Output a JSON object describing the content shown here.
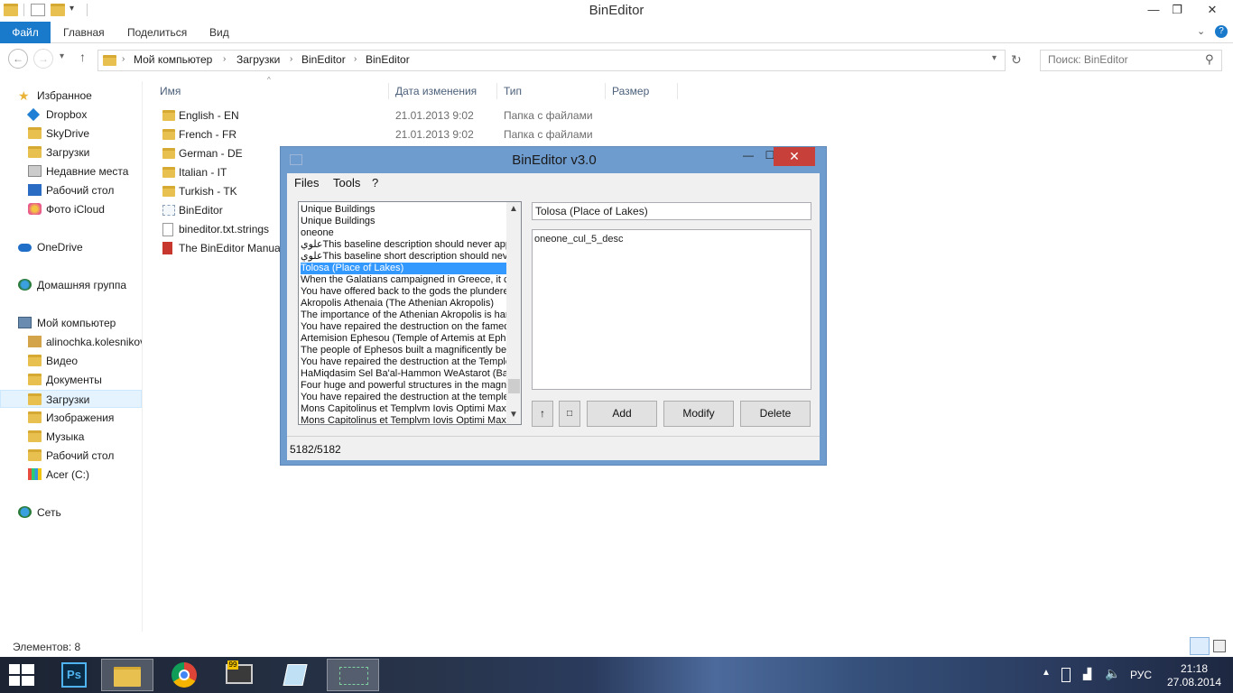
{
  "window_title": "BinEditor",
  "ribbon": {
    "file": "Файл",
    "tabs": [
      "Главная",
      "Поделиться",
      "Вид"
    ]
  },
  "address": {
    "path": [
      "Мой компьютер",
      "Загрузки",
      "BinEditor",
      "BinEditor"
    ]
  },
  "search": {
    "placeholder": "Поиск: BinEditor"
  },
  "nav": {
    "favorites": "Избранное",
    "fav_items": [
      "Dropbox",
      "SkyDrive",
      "Загрузки",
      "Недавние места",
      "Рабочий стол",
      "Фото iCloud"
    ],
    "onedrive": "OneDrive",
    "homegroup": "Домашняя группа",
    "computer": "Мой компьютер",
    "computer_items": [
      "alinochka.kolesnikov",
      "Видео",
      "Документы",
      "Загрузки",
      "Изображения",
      "Музыка",
      "Рабочий стол",
      "Acer (C:)"
    ],
    "network": "Сеть"
  },
  "columns": [
    "Имя",
    "Дата изменения",
    "Тип",
    "Размер"
  ],
  "files": [
    {
      "name": "English - EN",
      "date": "21.01.2013 9:02",
      "type": "Папка с файлами",
      "icon": "folder-icon"
    },
    {
      "name": "French - FR",
      "date": "21.01.2013 9:02",
      "type": "Папка с файлами",
      "icon": "folder-icon"
    },
    {
      "name": "German - DE",
      "date": "",
      "type": "",
      "icon": "folder-icon"
    },
    {
      "name": "Italian - IT",
      "date": "",
      "type": "",
      "icon": "folder-icon"
    },
    {
      "name": "Turkish - TK",
      "date": "",
      "type": "",
      "icon": "folder-icon"
    },
    {
      "name": "BinEditor",
      "date": "",
      "type": "",
      "icon": "app-icon"
    },
    {
      "name": "bineditor.txt.strings",
      "date": "",
      "type": "",
      "icon": "file-icon"
    },
    {
      "name": "The BinEditor Manua",
      "date": "",
      "type": "",
      "icon": "pdf-icon"
    }
  ],
  "status": "Элементов: 8",
  "bineditor": {
    "title": "BinEditor v3.0",
    "menus": [
      "Files",
      "Tools",
      "?"
    ],
    "list": [
      "Unique Buildings",
      "Unique Buildings",
      "oneone",
      "ﻋﻠﻮﻱThis baseline description should never app",
      "ﻋﻠﻮﻱThis baseline short description should nev",
      "Tolosa (Place of Lakes)",
      "When the Galatians campaigned in Greece, it c",
      "You have offered back to the gods the plundere",
      "Akropolis Athenaia (The Athenian Akropolis)",
      "The importance of the Athenian Akropolis is hard",
      "You have repaired the destruction on the famed",
      "Artemision Ephesou (Temple of Artemis at Ephes",
      "The people of Ephesos built a magnificently bea",
      "You have repaired the destruction at the Temple",
      "HaMiqdasim Sel Ba'al-Hammon WeAstarot (Ba'a",
      "Four huge and powerful structures in the magnifi",
      "You have repaired the destruction at the temple",
      "Mons Capitolinus et Templvm Iovis Optimi Maxim",
      "Mons Capitolinus et Templvm Iovis Optimi Maxim"
    ],
    "selected_index": 5,
    "name_value": "Tolosa (Place of Lakes)",
    "desc_value": "oneone_cul_5_desc",
    "buttons": {
      "up": "↑",
      "small": "□",
      "add": "Add",
      "modify": "Modify",
      "delete": "Delete"
    },
    "counter": "5182/5182"
  },
  "tray": {
    "lang": "РУС",
    "time": "21:18",
    "date": "27.08.2014"
  }
}
